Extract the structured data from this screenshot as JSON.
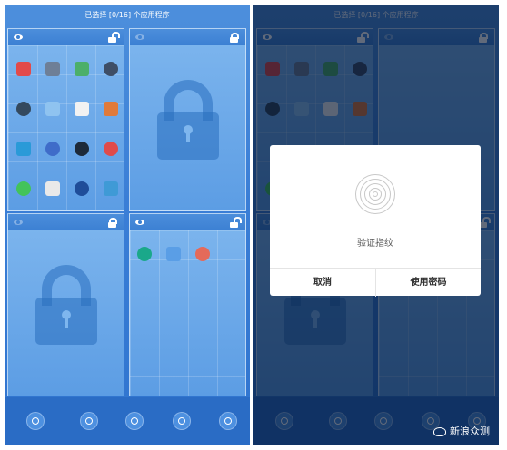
{
  "status_title": "已选择 [0/16] 个应用程序",
  "dialog": {
    "title": "验证指纹",
    "cancel_label": "取消",
    "password_label": "使用密码"
  },
  "watermark": "新浪众测",
  "colors": {
    "primary_blue": "#3a7ed6",
    "header_blue": "#3c80d3",
    "dialog_bg": "#ffffff"
  },
  "panels": [
    {
      "position": "top-left",
      "locked": false,
      "app_count": 16
    },
    {
      "position": "top-right",
      "locked": true,
      "app_count": 0
    },
    {
      "position": "bottom-left",
      "locked": true,
      "app_count": 0
    },
    {
      "position": "bottom-right",
      "locked": false,
      "app_count": 3
    }
  ],
  "dock_icons": [
    "settings-icon",
    "list-icon",
    "color-dots-icon",
    "check-icon",
    "menu-icon"
  ]
}
